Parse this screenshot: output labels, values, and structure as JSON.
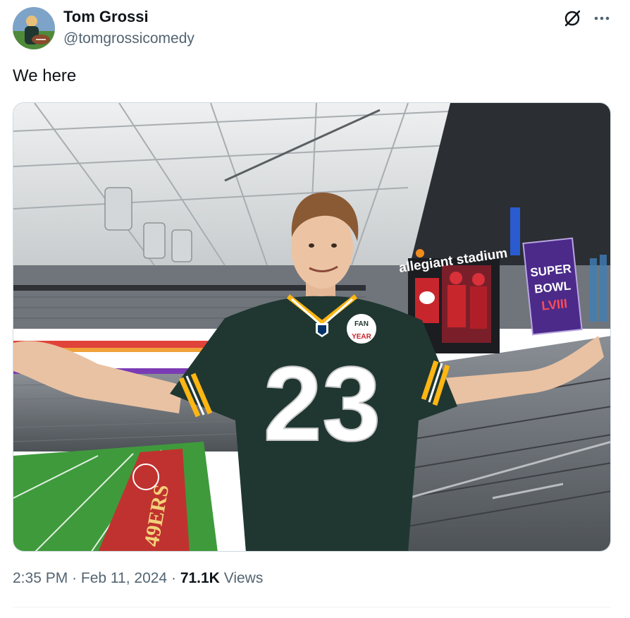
{
  "author": {
    "name": "Tom Grossi",
    "handle": "@tomgrossicomedy"
  },
  "tweet": {
    "text": "We here"
  },
  "meta": {
    "time": "2:35 PM",
    "separator": "·",
    "date": "Feb 11, 2024",
    "views_count": "71.1K",
    "views_label": "Views"
  },
  "photo": {
    "stadium_sign": "allegiant stadium",
    "super_bowl_line1": "SUPER",
    "super_bowl_line2": "BOWL",
    "super_bowl_line3": "LVIII",
    "jersey_number": "23",
    "patch_line1": "FAN",
    "patch_line2": "YEAR",
    "endzone_text": "49ERS"
  },
  "colors": {
    "text_primary": "#0f1419",
    "text_secondary": "#536471",
    "jersey_green": "#203731",
    "jersey_gold": "#ffb612"
  },
  "icons": {
    "grok": "grok-icon",
    "more": "more-icon"
  }
}
